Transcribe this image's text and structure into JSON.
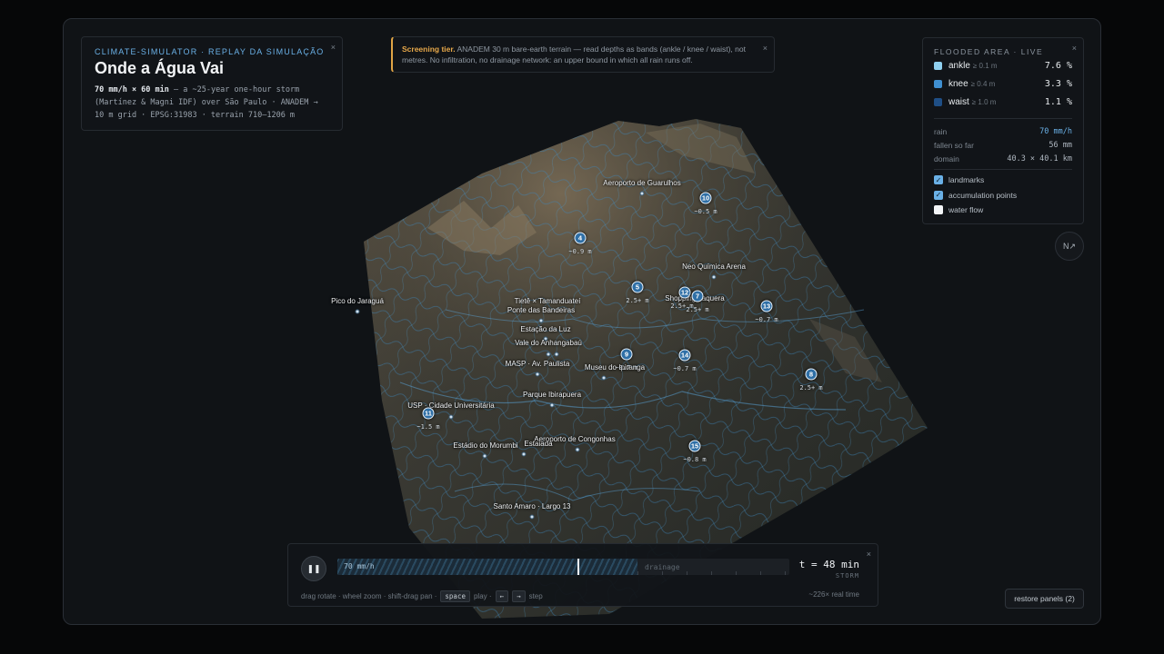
{
  "title_panel": {
    "kicker": "CLIMATE-SIMULATOR · REPLAY DA SIMULAÇÃO",
    "title": "Onde a Água Vai",
    "storm": "70 mm/h × 60 min",
    "desc_rest": " — a ~25-year one-hour storm (Martínez & Magni IDF) over São Paulo · ANADEM → 10 m grid · EPSG:31983 · terrain 710–1206 m",
    "close": "×"
  },
  "notice": {
    "heading": "Screening tier.",
    "text": " ANADEM 30 m bare-earth terrain — read depths as bands (ankle / knee / waist), not metres. No infiltration, no drainage network: an upper bound in which all rain runs off.",
    "close": "×"
  },
  "flood": {
    "header": "FLOODED AREA · LIVE",
    "close": "×",
    "levels": [
      {
        "name": "ankle",
        "threshold": "≥ 0.1 m",
        "pct": "7.6 %",
        "color": "#8fd0ef"
      },
      {
        "name": "knee",
        "threshold": "≥ 0.4 m",
        "pct": "3.3 %",
        "color": "#3f8fd0"
      },
      {
        "name": "waist",
        "threshold": "≥ 1.0 m",
        "pct": "1.1 %",
        "color": "#1f4f86"
      }
    ],
    "stats": [
      {
        "key": "rain",
        "value": "70 mm/h"
      },
      {
        "key": "fallen so far",
        "value": "56 mm"
      },
      {
        "key": "domain",
        "value": "40.3 × 40.1 km"
      }
    ],
    "toggles": [
      {
        "label": "landmarks",
        "checked": true
      },
      {
        "label": "accumulation points",
        "checked": true
      },
      {
        "label": "water flow",
        "checked": false
      }
    ]
  },
  "compass": {
    "label": "N↗",
    "close": "×"
  },
  "landmarks": [
    {
      "name": "Aeroporto de Guarulhos"
    },
    {
      "name": "Neo Química Arena"
    },
    {
      "name": "Pico do Jaraguá"
    },
    {
      "name": "Tietê × Tamanduateí"
    },
    {
      "name": "Ponte das Bandeiras"
    },
    {
      "name": "Estação da Luz"
    },
    {
      "name": "Vale do Anhangabaú"
    },
    {
      "name": "MASP · Av. Paulista"
    },
    {
      "name": "Museu do Ipiranga"
    },
    {
      "name": "Parque Ibirapuera"
    },
    {
      "name": "USP · Cidade Universitária"
    },
    {
      "name": "Estádio do Morumbi"
    },
    {
      "name": "Aeroporto de Congonhas"
    },
    {
      "name": "Santo Amaro · Largo 13"
    },
    {
      "name": "Shopping Itaquera"
    },
    {
      "name": "Estaiada"
    }
  ],
  "points": [
    {
      "id": "10",
      "depth": "~0.5 m"
    },
    {
      "id": "4",
      "depth": "~0.9 m"
    },
    {
      "id": "5",
      "depth": "2.5+ m"
    },
    {
      "id": "12",
      "depth": "2.5+ m"
    },
    {
      "id": "7",
      "depth": "2.5+ m"
    },
    {
      "id": "13",
      "depth": "~0.7 m"
    },
    {
      "id": "9",
      "depth": "~0.7 m"
    },
    {
      "id": "14",
      "depth": "~0.7 m"
    },
    {
      "id": "8",
      "depth": "2.5+ m"
    },
    {
      "id": "11",
      "depth": "~1.5 m"
    },
    {
      "id": "15",
      "depth": "~0.8 m"
    }
  ],
  "timeline": {
    "close": "×",
    "play_icon": "❚❚",
    "rain_label": "70 mm/h",
    "drain_label": "drainage",
    "time": "t = 48 min",
    "phase": "STORM",
    "hint_1": "drag rotate · wheel zoom · shift-drag pan ·",
    "key_space": "space",
    "hint_2": "play ·",
    "key_left": "←",
    "key_right": "→",
    "hint_3": "step",
    "speed": "~226× real time"
  },
  "restore": "restore panels (2)"
}
